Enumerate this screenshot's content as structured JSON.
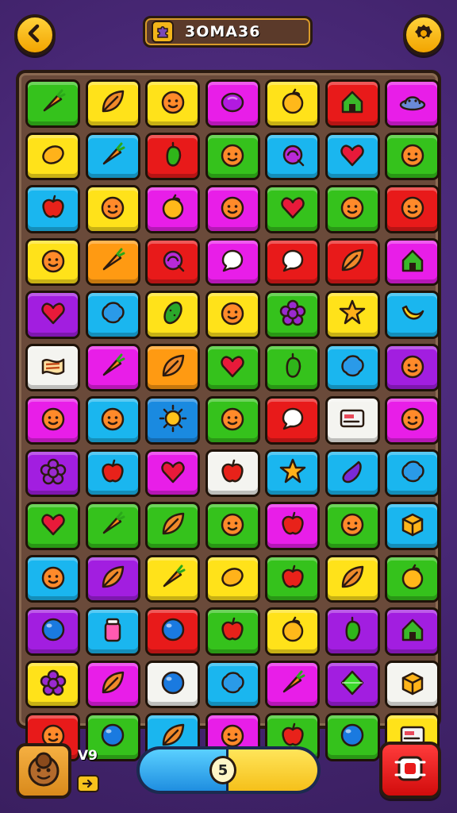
{
  "header": {
    "title": "3OMA36",
    "back_icon": "back-arrow-icon",
    "settings_icon": "gear-icon",
    "title_icon": "puzzle-piece-icon"
  },
  "footer": {
    "level_label": "V9",
    "progress_value": "5",
    "progress_fraction": 0.5,
    "avatar_icon": "character-face-icon",
    "shuffle_icon": "shuffle-icon"
  },
  "palette": {
    "green": "#35c21c",
    "yellow": "#ffe21a",
    "red": "#e81a1a",
    "purple": "#a21ee0",
    "cyan": "#1ab6ef",
    "orange": "#ff9a12",
    "magenta": "#e81ee8",
    "white": "#f4f4f0",
    "blue": "#1a8ae0"
  },
  "board": {
    "rows": [
      [
        {
          "c": "green",
          "i": "carrot"
        },
        {
          "c": "yellow",
          "i": "leaf"
        },
        {
          "c": "yellow",
          "i": "face"
        },
        {
          "c": "magenta",
          "i": "plum"
        },
        {
          "c": "yellow",
          "i": "fruit"
        },
        {
          "c": "red",
          "i": "house"
        },
        {
          "c": "magenta",
          "i": "ufo"
        }
      ],
      [
        {
          "c": "yellow",
          "i": "lemon"
        },
        {
          "c": "cyan",
          "i": "carrot"
        },
        {
          "c": "red",
          "i": "pepper"
        },
        {
          "c": "green",
          "i": "face"
        },
        {
          "c": "cyan",
          "i": "candy"
        },
        {
          "c": "cyan",
          "i": "heart"
        },
        {
          "c": "green",
          "i": "face"
        }
      ],
      [
        {
          "c": "cyan",
          "i": "apple"
        },
        {
          "c": "yellow",
          "i": "face"
        },
        {
          "c": "magenta",
          "i": "fruit"
        },
        {
          "c": "magenta",
          "i": "face"
        },
        {
          "c": "green",
          "i": "heart"
        },
        {
          "c": "green",
          "i": "face"
        },
        {
          "c": "red",
          "i": "face"
        }
      ],
      [
        {
          "c": "yellow",
          "i": "face"
        },
        {
          "c": "orange",
          "i": "carrot"
        },
        {
          "c": "red",
          "i": "candy"
        },
        {
          "c": "magenta",
          "i": "bubble"
        },
        {
          "c": "red",
          "i": "bubble"
        },
        {
          "c": "red",
          "i": "leaf"
        },
        {
          "c": "magenta",
          "i": "house"
        }
      ],
      [
        {
          "c": "purple",
          "i": "heart"
        },
        {
          "c": "cyan",
          "i": "blob"
        },
        {
          "c": "yellow",
          "i": "pickle"
        },
        {
          "c": "yellow",
          "i": "face"
        },
        {
          "c": "green",
          "i": "flower"
        },
        {
          "c": "yellow",
          "i": "star"
        },
        {
          "c": "cyan",
          "i": "banana"
        }
      ],
      [
        {
          "c": "white",
          "i": "bread"
        },
        {
          "c": "magenta",
          "i": "carrot"
        },
        {
          "c": "orange",
          "i": "leaf"
        },
        {
          "c": "green",
          "i": "heart"
        },
        {
          "c": "green",
          "i": "pepper"
        },
        {
          "c": "cyan",
          "i": "blob"
        },
        {
          "c": "purple",
          "i": "face"
        }
      ],
      [
        {
          "c": "magenta",
          "i": "face"
        },
        {
          "c": "cyan",
          "i": "face"
        },
        {
          "c": "blue",
          "i": "sun"
        },
        {
          "c": "green",
          "i": "face"
        },
        {
          "c": "red",
          "i": "bubble"
        },
        {
          "c": "white",
          "i": "card"
        },
        {
          "c": "magenta",
          "i": "face"
        }
      ],
      [
        {
          "c": "purple",
          "i": "flower"
        },
        {
          "c": "cyan",
          "i": "apple"
        },
        {
          "c": "magenta",
          "i": "heart"
        },
        {
          "c": "white",
          "i": "apple"
        },
        {
          "c": "cyan",
          "i": "star"
        },
        {
          "c": "cyan",
          "i": "eggplant"
        },
        {
          "c": "cyan",
          "i": "blob"
        }
      ],
      [
        {
          "c": "green",
          "i": "heart"
        },
        {
          "c": "green",
          "i": "carrot"
        },
        {
          "c": "green",
          "i": "leaf"
        },
        {
          "c": "green",
          "i": "face"
        },
        {
          "c": "magenta",
          "i": "apple"
        },
        {
          "c": "green",
          "i": "face"
        },
        {
          "c": "cyan",
          "i": "box"
        }
      ],
      [
        {
          "c": "cyan",
          "i": "face"
        },
        {
          "c": "purple",
          "i": "leaf"
        },
        {
          "c": "yellow",
          "i": "carrot"
        },
        {
          "c": "yellow",
          "i": "lemon"
        },
        {
          "c": "green",
          "i": "apple"
        },
        {
          "c": "yellow",
          "i": "leaf"
        },
        {
          "c": "green",
          "i": "fruit"
        }
      ],
      [
        {
          "c": "purple",
          "i": "ball"
        },
        {
          "c": "cyan",
          "i": "jar"
        },
        {
          "c": "red",
          "i": "ball"
        },
        {
          "c": "green",
          "i": "apple"
        },
        {
          "c": "yellow",
          "i": "fruit"
        },
        {
          "c": "purple",
          "i": "pepper"
        },
        {
          "c": "purple",
          "i": "house"
        }
      ],
      [
        {
          "c": "yellow",
          "i": "flower"
        },
        {
          "c": "magenta",
          "i": "leaf"
        },
        {
          "c": "white",
          "i": "ball"
        },
        {
          "c": "cyan",
          "i": "blob"
        },
        {
          "c": "magenta",
          "i": "carrot"
        },
        {
          "c": "purple",
          "i": "gem"
        },
        {
          "c": "white",
          "i": "box"
        }
      ],
      [
        {
          "c": "red",
          "i": "face"
        },
        {
          "c": "green",
          "i": "ball"
        },
        {
          "c": "cyan",
          "i": "leaf"
        },
        {
          "c": "magenta",
          "i": "face"
        },
        {
          "c": "green",
          "i": "apple"
        },
        {
          "c": "green",
          "i": "ball"
        },
        {
          "c": "yellow",
          "i": "card"
        }
      ]
    ]
  }
}
